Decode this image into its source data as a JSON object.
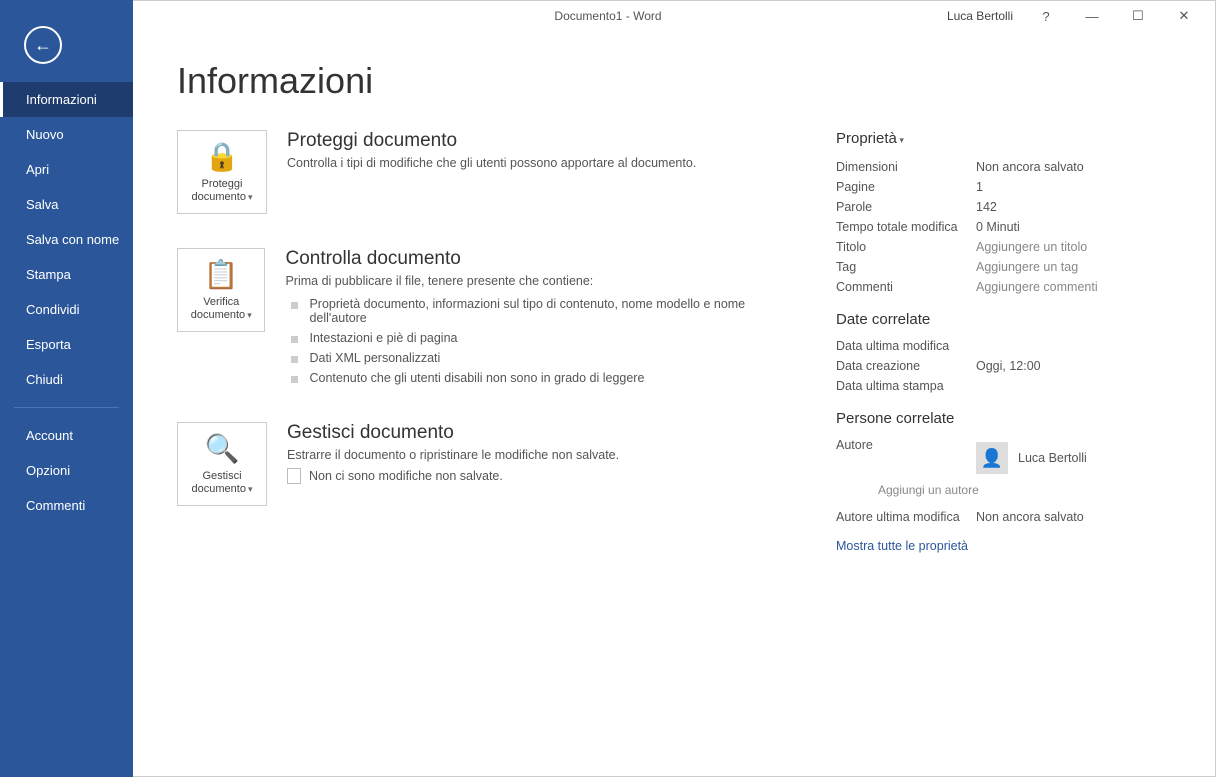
{
  "titlebar": {
    "title": "Documento1 - Word",
    "user": "Luca Bertolli"
  },
  "sidebar": {
    "items": [
      "Informazioni",
      "Nuovo",
      "Apri",
      "Salva",
      "Salva con nome",
      "Stampa",
      "Condividi",
      "Esporta",
      "Chiudi"
    ],
    "items2": [
      "Account",
      "Opzioni",
      "Commenti"
    ]
  },
  "page": {
    "heading": "Informazioni"
  },
  "sec1": {
    "btn": "Proteggi documento",
    "title": "Proteggi documento",
    "desc": "Controlla i tipi di modifiche che gli utenti possono apportare al documento."
  },
  "sec2": {
    "btn": "Verifica documento",
    "title": "Controlla documento",
    "desc": "Prima di pubblicare il file, tenere presente che contiene:",
    "items": [
      "Proprietà documento, informazioni sul tipo di contenuto, nome modello e nome dell'autore",
      "Intestazioni e piè di pagina",
      "Dati XML personalizzati",
      "Contenuto che gli utenti disabili non sono in grado di leggere"
    ]
  },
  "sec3": {
    "btn": "Gestisci documento",
    "title": "Gestisci documento",
    "desc": "Estrarre il documento o ripristinare le modifiche non salvate.",
    "nochanges": "Non ci sono modifiche non salvate."
  },
  "props": {
    "header": "Proprietà",
    "rows": [
      {
        "k": "Dimensioni",
        "v": "Non ancora salvato"
      },
      {
        "k": "Pagine",
        "v": "1"
      },
      {
        "k": "Parole",
        "v": "142"
      },
      {
        "k": "Tempo totale modifica",
        "v": "0 Minuti"
      },
      {
        "k": "Titolo",
        "v": "Aggiungere un titolo",
        "ph": true
      },
      {
        "k": "Tag",
        "v": "Aggiungere un tag",
        "ph": true
      },
      {
        "k": "Commenti",
        "v": "Aggiungere commenti",
        "ph": true
      }
    ],
    "dates_header": "Date correlate",
    "dates": [
      {
        "k": "Data ultima modifica",
        "v": ""
      },
      {
        "k": "Data creazione",
        "v": "Oggi, 12:00"
      },
      {
        "k": "Data ultima stampa",
        "v": ""
      }
    ],
    "people_header": "Persone correlate",
    "author_label": "Autore",
    "author_name": "Luca Bertolli",
    "add_author": "Aggiungi un autore",
    "lastmod_label": "Autore ultima modifica",
    "lastmod_value": "Non ancora salvato",
    "showall": "Mostra tutte le proprietà"
  }
}
